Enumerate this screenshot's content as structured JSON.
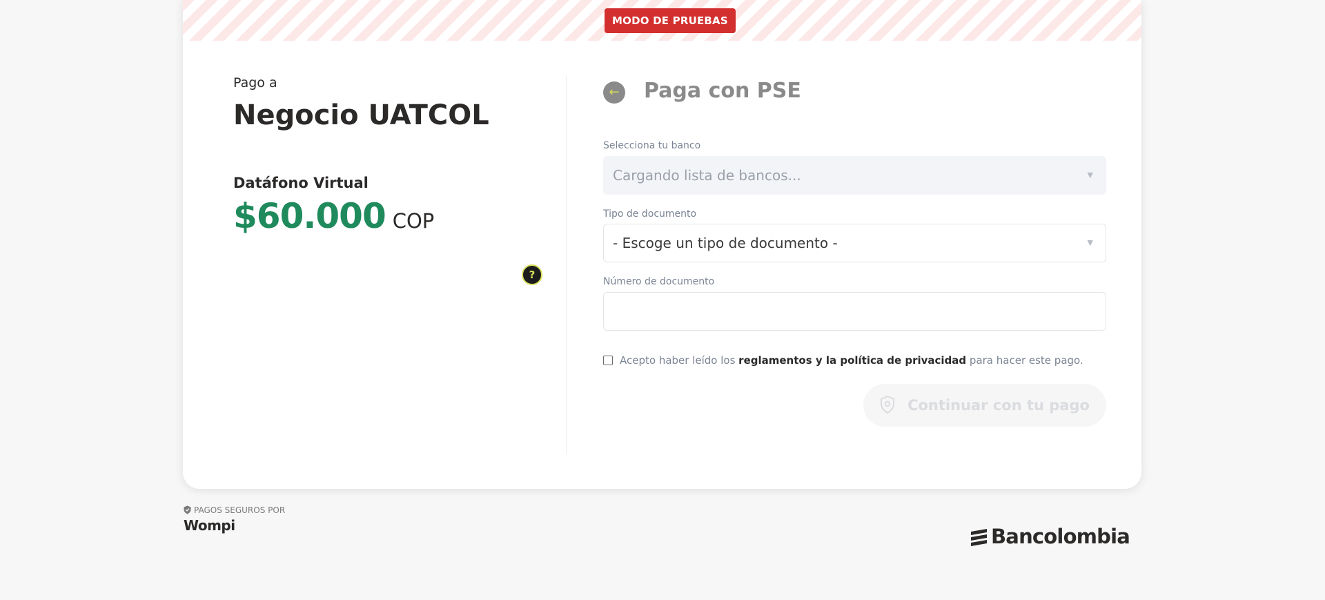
{
  "banner": {
    "badge_label": "MODO DE PRUEBAS"
  },
  "summary": {
    "pay_to_label": "Pago a",
    "merchant_name": "Negocio UATCOL",
    "product_name": "Datáfono Virtual",
    "amount": "$60.000",
    "currency": "COP",
    "help_label": "?"
  },
  "payment": {
    "title": "Paga con PSE",
    "back_label": "←",
    "bank": {
      "label": "Selecciona tu banco",
      "value": "Cargando lista de bancos..."
    },
    "doc_type": {
      "label": "Tipo de documento",
      "value": "- Escoge un tipo de documento -"
    },
    "doc_number": {
      "label": "Número de documento",
      "value": ""
    },
    "terms": {
      "prefix": "Acepto haber leído los ",
      "link": "reglamentos y la política de privacidad",
      "suffix": " para hacer este pago."
    },
    "continue_label": "Continuar con tu pago"
  },
  "footer": {
    "secure_label": "PAGOS SEGUROS POR",
    "wompi_logo_text": "Wompi",
    "bank_logo_text": "Bancolombia"
  },
  "colors": {
    "test_badge": "#d32f2f",
    "amount": "#1f8a5c",
    "accent": "#d8e05a"
  },
  "icons": {
    "back": "arrow-left-icon",
    "help": "question-icon",
    "chevron": "chevron-down-icon",
    "shield": "shield-icon"
  }
}
